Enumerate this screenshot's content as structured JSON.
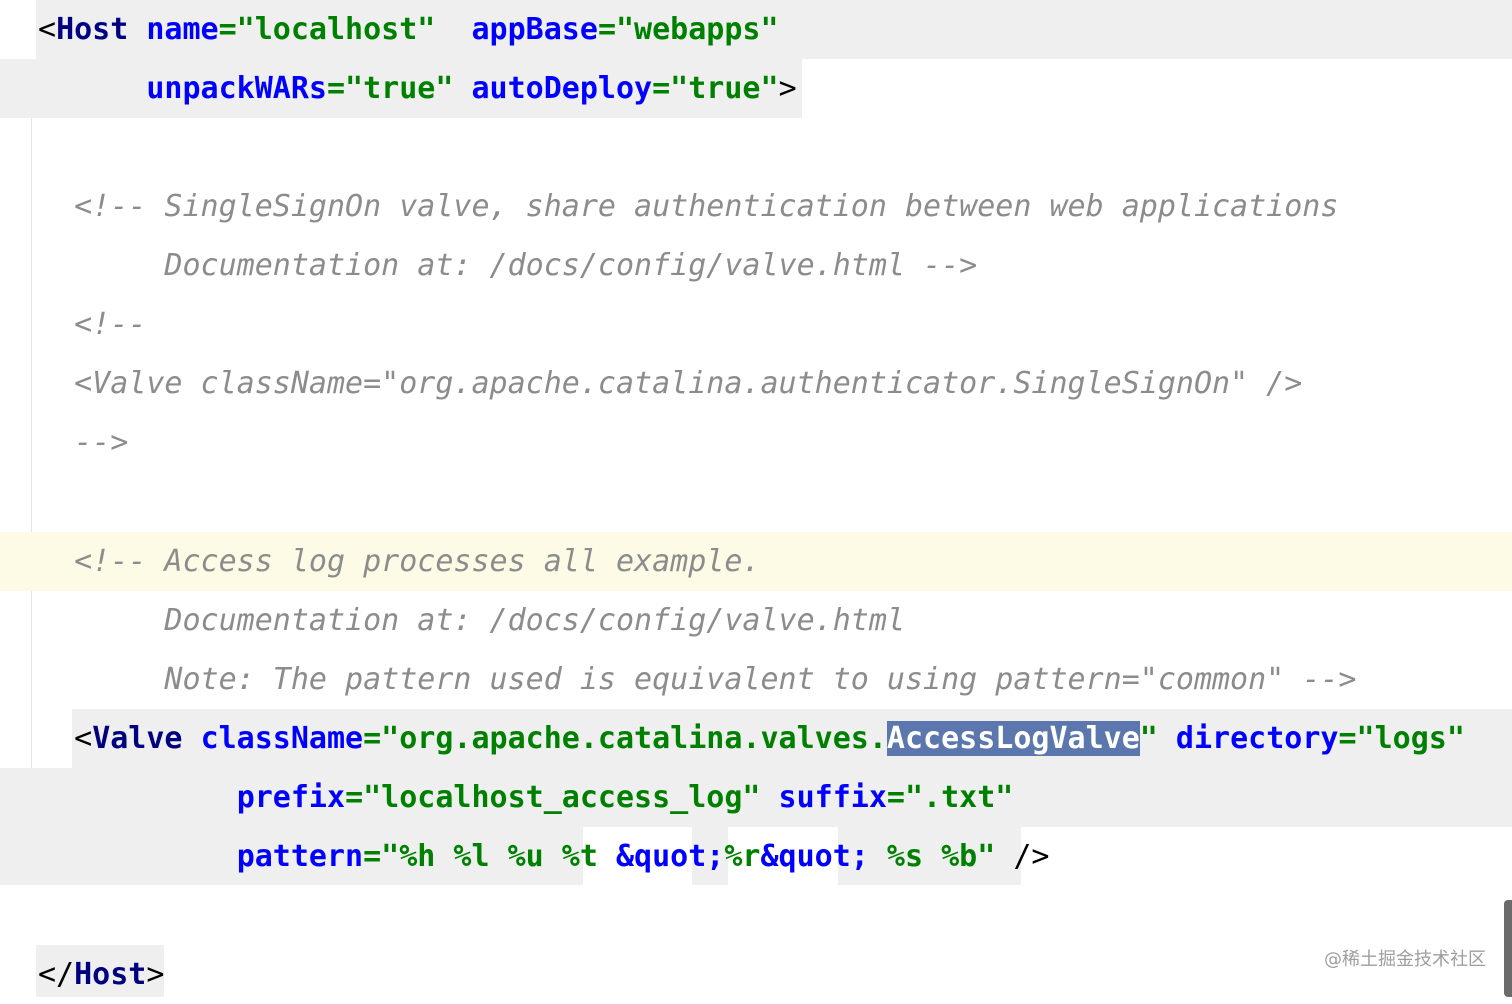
{
  "editor": {
    "lines": {
      "l1": {
        "s1": "<",
        "s2": "Host",
        "s3": " ",
        "s4": "name",
        "s5": "=\"localhost\"",
        "s6": "  ",
        "s7": "appBase",
        "s8": "=\"webapps\""
      },
      "l2": {
        "s1": "      ",
        "s2": "unpackWARs",
        "s3": "=\"true\"",
        "s4": " ",
        "s5": "autoDeploy",
        "s6": "=\"true\"",
        "s7": ">"
      },
      "l3": {
        "s1": "  <!-- SingleSignOn valve, share authentication between web applications"
      },
      "l4": {
        "s1": "       Documentation at: /docs/config/valve.html -->"
      },
      "l5": {
        "s1": "  <!--"
      },
      "l6": {
        "s1": "  <Valve className=\"org.apache.catalina.authenticator.SingleSignOn\" />"
      },
      "l7": {
        "s1": "  -->"
      },
      "l8": {
        "s1": "  <!-- Access log processes all example."
      },
      "l9": {
        "s1": "       Documentation at: /docs/config/valve.html"
      },
      "l10": {
        "s1": "       Note: The pattern used is equivalent to using pattern=\"common\" -->"
      },
      "l11": {
        "s1": "  <",
        "s2": "Valve",
        "s3": " ",
        "s4": "className",
        "s5": "=\"org.apache.catalina.valves.",
        "s6": "AccessLogValve",
        "s7": "\"",
        "s8": " ",
        "s9": "directory",
        "s10": "=\"logs\""
      },
      "l12": {
        "s1": "           ",
        "s2": "prefix",
        "s3": "=\"localhost_access_log\"",
        "s4": " ",
        "s5": "suffix",
        "s6": "=\".txt\""
      },
      "l13": {
        "s1": "           ",
        "s2": "pattern",
        "s3": "=\"%h %l %u %t ",
        "s4": "&quot;",
        "s5": "%r",
        "s6": "&quot;",
        "s7": " %s %b\"",
        "s8": " />"
      },
      "l14": {
        "s1": "</",
        "s2": "Host",
        "s3": ">"
      }
    },
    "colors": {
      "tag": "#000080",
      "attribute": "#0000ff",
      "value": "#008000",
      "comment": "#8c8c8c",
      "selection": "#5b77ad",
      "caret_line": "#fdfbe6",
      "tag_highlight": "#efefef"
    }
  },
  "watermark": "@稀土掘金技术社区"
}
